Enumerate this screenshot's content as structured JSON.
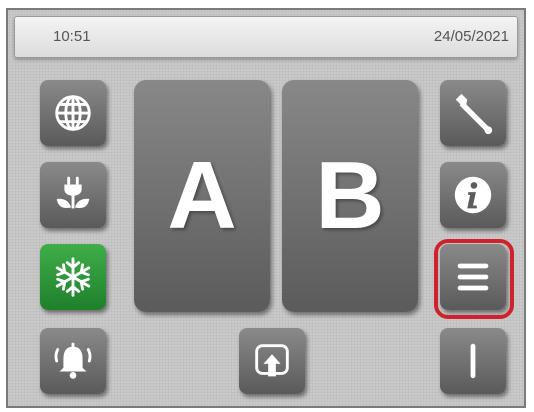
{
  "status_bar": {
    "time": "10:51",
    "date": "24/05/2021"
  },
  "big_buttons": {
    "a_label": "A",
    "b_label": "B"
  },
  "left_column": [
    {
      "icon": "globe-icon"
    },
    {
      "icon": "plug-leaf-icon"
    },
    {
      "icon": "snowflake-icon",
      "state": "active",
      "color": "#2e9a3a"
    },
    {
      "icon": "alarm-bell-icon"
    }
  ],
  "right_column": [
    {
      "icon": "wrench-icon"
    },
    {
      "icon": "info-icon"
    },
    {
      "icon": "menu-icon",
      "highlight_color": "#d0222c"
    },
    {
      "icon": "vertical-bar-icon"
    }
  ],
  "bottom_center": {
    "icon": "upload-icon"
  }
}
